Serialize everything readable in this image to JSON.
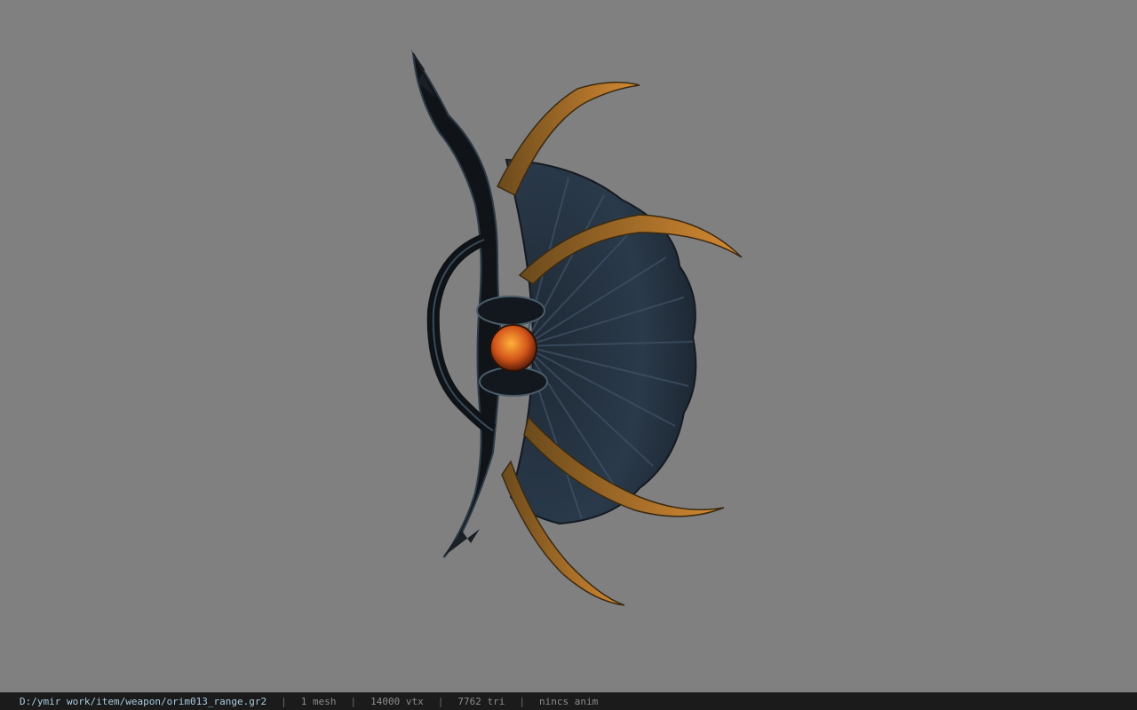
{
  "status": {
    "path": "D:/ymir work/item/weapon/orim013_range.gr2",
    "separator": "|",
    "mesh": "1 mesh",
    "vertices": "14000 vtx",
    "triangles": "7762 tri",
    "anim": "nincs anim"
  },
  "colors": {
    "background": "#808080",
    "statusbar": "#1b1b1b",
    "path_text": "#a9cbe0",
    "info_text": "#8c8c8c"
  }
}
